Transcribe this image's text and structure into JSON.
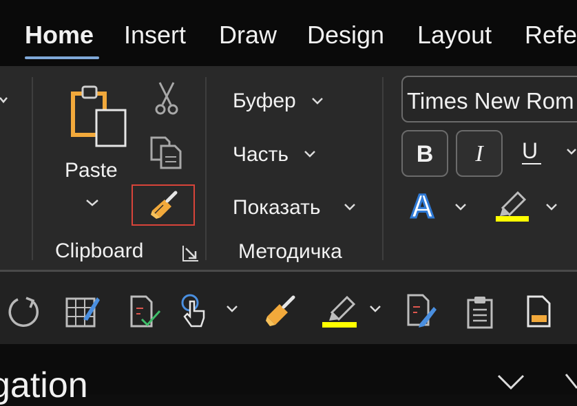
{
  "tabs": {
    "home": "Home",
    "insert": "Insert",
    "draw": "Draw",
    "design": "Design",
    "layout": "Layout",
    "references": "Refe"
  },
  "clipboard": {
    "paste_label": "Paste",
    "group_label": "Clipboard",
    "icons": [
      "paste-icon",
      "cut-icon",
      "copy-icon",
      "format-painter-icon",
      "dialog-launcher-icon"
    ]
  },
  "custom_group": {
    "items": [
      "Буфер",
      "Часть",
      "Показать"
    ],
    "group_label": "Методичка"
  },
  "font": {
    "name": "Times New Rom",
    "bold": "B",
    "italic": "I",
    "underline": "U",
    "text_effects_letter": "A",
    "highlight_color": "#ffff00",
    "font_color_outline": "#2f7ad6"
  },
  "quick_access": {
    "icons": [
      "redo-icon",
      "table-edit-icon",
      "check-document-icon",
      "touch-mode-icon",
      "format-painter-icon",
      "highlighter-icon",
      "edit-document-icon",
      "clipboard-icon",
      "document-icon"
    ]
  },
  "nav_pane": {
    "title": "gation"
  },
  "colors": {
    "accent_tab_underline": "#7fa8d8",
    "selection_border": "#d9443a",
    "brush_orange": "#f2a93b"
  }
}
